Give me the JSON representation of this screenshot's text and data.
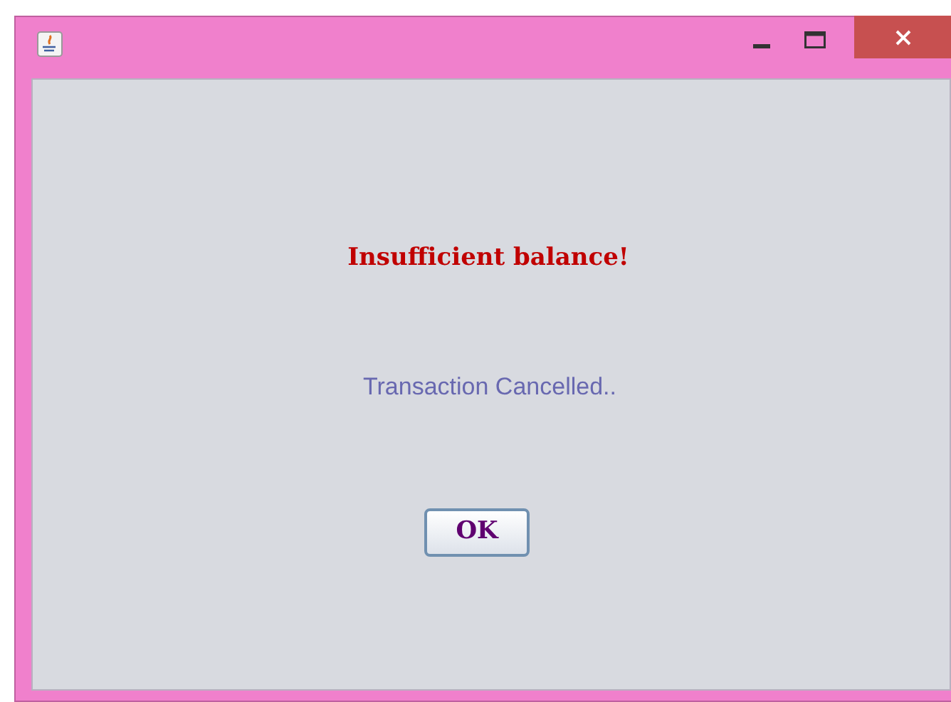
{
  "dialog": {
    "message": "Insufficient balance!",
    "detail": "Transaction Cancelled..",
    "button": "OK"
  }
}
